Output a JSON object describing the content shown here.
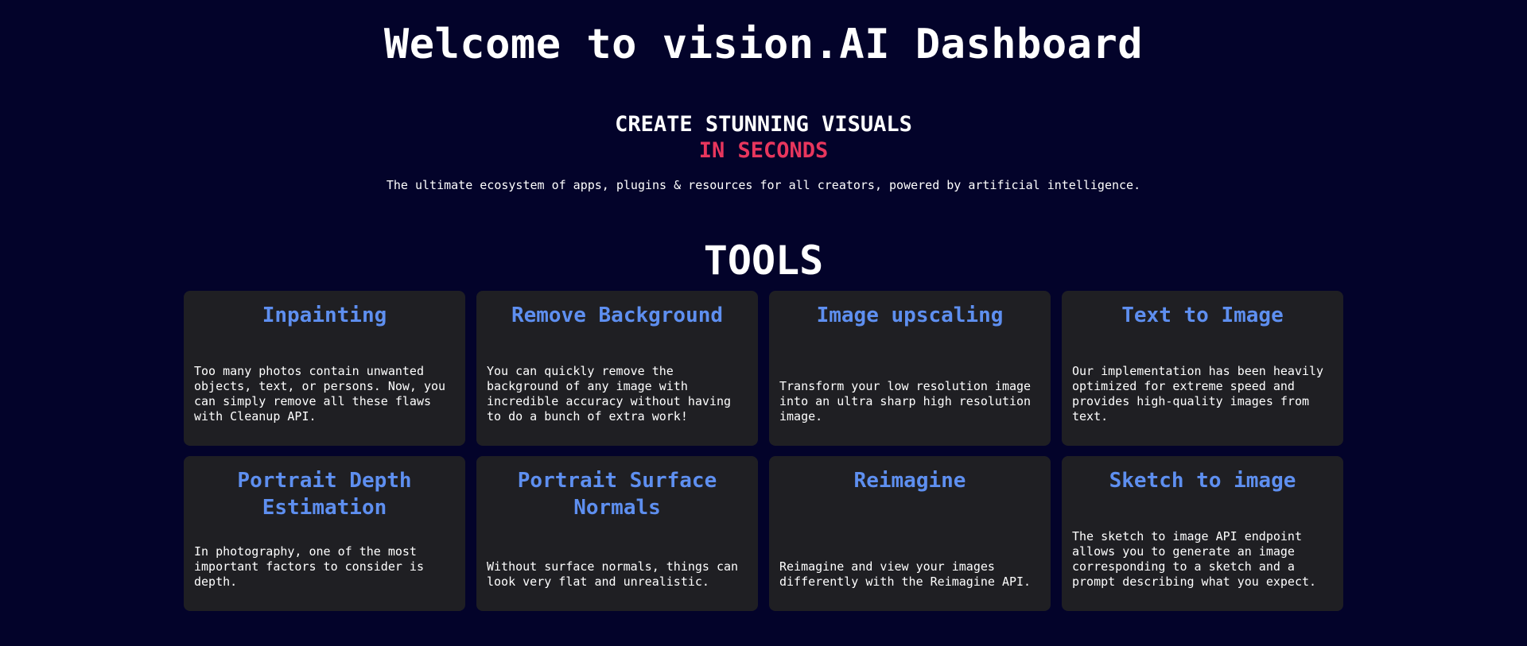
{
  "hero": {
    "title": "Welcome to vision.AI Dashboard",
    "tagline_line1": "CREATE STUNNING VISUALS",
    "tagline_line2": "IN SECONDS",
    "lede": "The ultimate ecosystem of apps, plugins & resources for all creators, powered by artificial intelligence."
  },
  "tools": {
    "heading": "TOOLS",
    "items": [
      {
        "title": "Inpainting",
        "description": "Too many photos contain unwanted objects, text, or persons. Now, you can simply remove all these flaws with Cleanup API."
      },
      {
        "title": "Remove Background",
        "description": "You can quickly remove the background of any image with incredible accuracy without having to do a bunch of extra work!"
      },
      {
        "title": "Image upscaling",
        "description": "Transform your low resolution image into an ultra sharp high resolution image."
      },
      {
        "title": "Text to Image",
        "description": "Our implementation has been heavily optimized for extreme speed and provides high-quality images from text."
      },
      {
        "title": "Portrait Depth Estimation",
        "description": "In photography, one of the most important factors to consider is depth."
      },
      {
        "title": "Portrait Surface Normals",
        "description": "Without surface normals, things can look very flat and unrealistic."
      },
      {
        "title": "Reimagine",
        "description": "Reimagine and view your images differently with the Reimagine API."
      },
      {
        "title": "Sketch to image",
        "description": "The sketch to image API endpoint allows you to generate an image corresponding to a sketch and a prompt describing what you expect."
      }
    ]
  },
  "colors": {
    "background": "#03032a",
    "card_background": "#1f1f23",
    "accent_red": "#e8365d",
    "card_title_blue": "#5e8ff0",
    "text": "#ffffff"
  }
}
